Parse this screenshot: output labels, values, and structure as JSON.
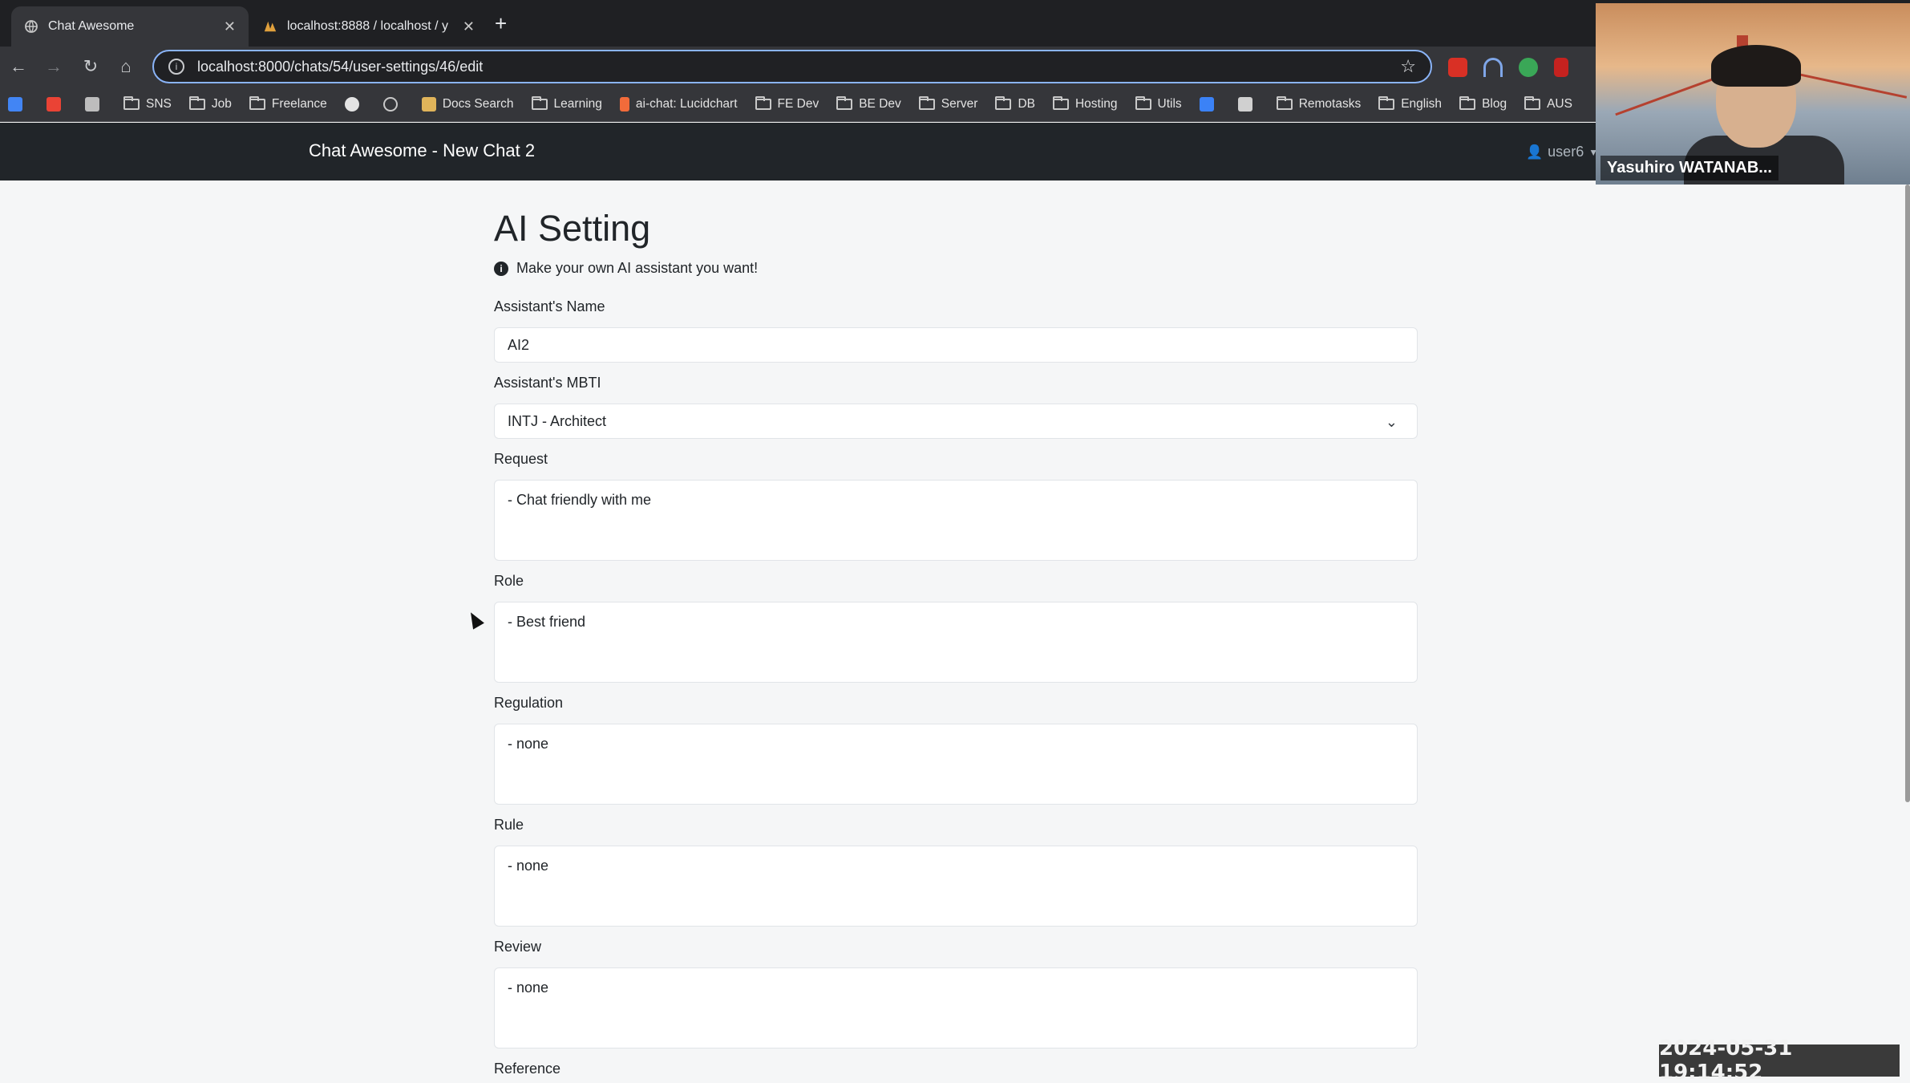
{
  "browser": {
    "tabs": [
      {
        "title": "Chat Awesome",
        "active": true,
        "icon": "globe-icon"
      },
      {
        "title": "localhost:8888 / localhost / y",
        "active": false,
        "icon": "phpmyadmin-icon"
      }
    ],
    "new_tab": "+",
    "url": "localhost:8000/chats/54/user-settings/46/edit",
    "bookmarks": [
      {
        "label": "SNS",
        "icon": "folder-icon"
      },
      {
        "label": "Job",
        "icon": "folder-icon"
      },
      {
        "label": "Freelance",
        "icon": "folder-icon"
      },
      {
        "label": "",
        "icon": "github-icon"
      },
      {
        "label": "",
        "icon": "globe-icon"
      },
      {
        "label": "Docs Search",
        "icon": "docs-icon"
      },
      {
        "label": "Learning",
        "icon": "folder-icon"
      },
      {
        "label": "ai-chat: Lucidchart",
        "icon": "lucidchart-icon"
      },
      {
        "label": "FE Dev",
        "icon": "folder-icon"
      },
      {
        "label": "BE Dev",
        "icon": "folder-icon"
      },
      {
        "label": "Server",
        "icon": "folder-icon"
      },
      {
        "label": "DB",
        "icon": "folder-icon"
      },
      {
        "label": "Hosting",
        "icon": "folder-icon"
      },
      {
        "label": "Utils",
        "icon": "folder-icon"
      },
      {
        "label": "",
        "icon": "app-icon"
      },
      {
        "label": "",
        "icon": "app-icon"
      },
      {
        "label": "Remotasks",
        "icon": "folder-icon"
      },
      {
        "label": "English",
        "icon": "folder-icon"
      },
      {
        "label": "Blog",
        "icon": "folder-icon"
      },
      {
        "label": "AUS",
        "icon": "folder-icon"
      }
    ]
  },
  "app": {
    "brand": "Chat Awesome - New Chat 2",
    "user": "user6"
  },
  "form": {
    "title": "AI Setting",
    "hint": "Make your own AI assistant you want!",
    "name_label": "Assistant's Name",
    "name_value": "AI2",
    "mbti_label": "Assistant's MBTI",
    "mbti_value": "INTJ - Architect",
    "request_label": "Request",
    "request_value": "- Chat friendly with me",
    "role_label": "Role",
    "role_value": "- Best friend",
    "regulation_label": "Regulation",
    "regulation_value": "- none",
    "rule_label": "Rule",
    "rule_value": "- none",
    "review_label": "Review",
    "review_value": "- none",
    "reference_label": "Reference"
  },
  "video": {
    "participant": "Yasuhiro WATANAB..."
  },
  "timestamp": "2024-05-31  19:14:52",
  "colors": {
    "navbar": "#212529",
    "focus_ring": "#8ab4f8"
  }
}
